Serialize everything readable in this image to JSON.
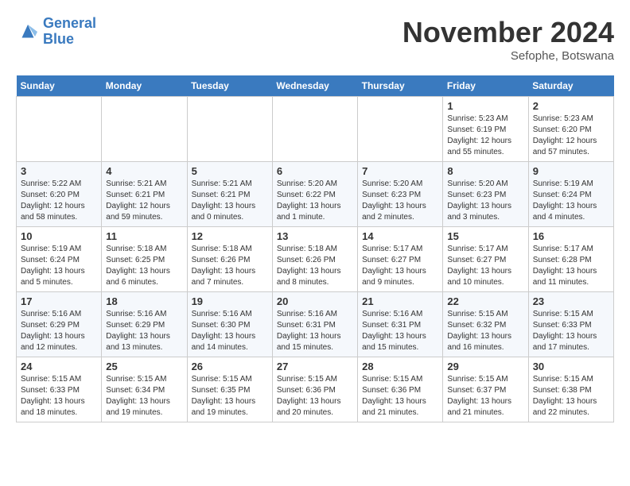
{
  "header": {
    "logo_line1": "General",
    "logo_line2": "Blue",
    "month_title": "November 2024",
    "location": "Sefophe, Botswana"
  },
  "days_of_week": [
    "Sunday",
    "Monday",
    "Tuesday",
    "Wednesday",
    "Thursday",
    "Friday",
    "Saturday"
  ],
  "weeks": [
    [
      {
        "day": "",
        "info": ""
      },
      {
        "day": "",
        "info": ""
      },
      {
        "day": "",
        "info": ""
      },
      {
        "day": "",
        "info": ""
      },
      {
        "day": "",
        "info": ""
      },
      {
        "day": "1",
        "info": "Sunrise: 5:23 AM\nSunset: 6:19 PM\nDaylight: 12 hours\nand 55 minutes."
      },
      {
        "day": "2",
        "info": "Sunrise: 5:23 AM\nSunset: 6:20 PM\nDaylight: 12 hours\nand 57 minutes."
      }
    ],
    [
      {
        "day": "3",
        "info": "Sunrise: 5:22 AM\nSunset: 6:20 PM\nDaylight: 12 hours\nand 58 minutes."
      },
      {
        "day": "4",
        "info": "Sunrise: 5:21 AM\nSunset: 6:21 PM\nDaylight: 12 hours\nand 59 minutes."
      },
      {
        "day": "5",
        "info": "Sunrise: 5:21 AM\nSunset: 6:21 PM\nDaylight: 13 hours\nand 0 minutes."
      },
      {
        "day": "6",
        "info": "Sunrise: 5:20 AM\nSunset: 6:22 PM\nDaylight: 13 hours\nand 1 minute."
      },
      {
        "day": "7",
        "info": "Sunrise: 5:20 AM\nSunset: 6:23 PM\nDaylight: 13 hours\nand 2 minutes."
      },
      {
        "day": "8",
        "info": "Sunrise: 5:20 AM\nSunset: 6:23 PM\nDaylight: 13 hours\nand 3 minutes."
      },
      {
        "day": "9",
        "info": "Sunrise: 5:19 AM\nSunset: 6:24 PM\nDaylight: 13 hours\nand 4 minutes."
      }
    ],
    [
      {
        "day": "10",
        "info": "Sunrise: 5:19 AM\nSunset: 6:24 PM\nDaylight: 13 hours\nand 5 minutes."
      },
      {
        "day": "11",
        "info": "Sunrise: 5:18 AM\nSunset: 6:25 PM\nDaylight: 13 hours\nand 6 minutes."
      },
      {
        "day": "12",
        "info": "Sunrise: 5:18 AM\nSunset: 6:26 PM\nDaylight: 13 hours\nand 7 minutes."
      },
      {
        "day": "13",
        "info": "Sunrise: 5:18 AM\nSunset: 6:26 PM\nDaylight: 13 hours\nand 8 minutes."
      },
      {
        "day": "14",
        "info": "Sunrise: 5:17 AM\nSunset: 6:27 PM\nDaylight: 13 hours\nand 9 minutes."
      },
      {
        "day": "15",
        "info": "Sunrise: 5:17 AM\nSunset: 6:27 PM\nDaylight: 13 hours\nand 10 minutes."
      },
      {
        "day": "16",
        "info": "Sunrise: 5:17 AM\nSunset: 6:28 PM\nDaylight: 13 hours\nand 11 minutes."
      }
    ],
    [
      {
        "day": "17",
        "info": "Sunrise: 5:16 AM\nSunset: 6:29 PM\nDaylight: 13 hours\nand 12 minutes."
      },
      {
        "day": "18",
        "info": "Sunrise: 5:16 AM\nSunset: 6:29 PM\nDaylight: 13 hours\nand 13 minutes."
      },
      {
        "day": "19",
        "info": "Sunrise: 5:16 AM\nSunset: 6:30 PM\nDaylight: 13 hours\nand 14 minutes."
      },
      {
        "day": "20",
        "info": "Sunrise: 5:16 AM\nSunset: 6:31 PM\nDaylight: 13 hours\nand 15 minutes."
      },
      {
        "day": "21",
        "info": "Sunrise: 5:16 AM\nSunset: 6:31 PM\nDaylight: 13 hours\nand 15 minutes."
      },
      {
        "day": "22",
        "info": "Sunrise: 5:15 AM\nSunset: 6:32 PM\nDaylight: 13 hours\nand 16 minutes."
      },
      {
        "day": "23",
        "info": "Sunrise: 5:15 AM\nSunset: 6:33 PM\nDaylight: 13 hours\nand 17 minutes."
      }
    ],
    [
      {
        "day": "24",
        "info": "Sunrise: 5:15 AM\nSunset: 6:33 PM\nDaylight: 13 hours\nand 18 minutes."
      },
      {
        "day": "25",
        "info": "Sunrise: 5:15 AM\nSunset: 6:34 PM\nDaylight: 13 hours\nand 19 minutes."
      },
      {
        "day": "26",
        "info": "Sunrise: 5:15 AM\nSunset: 6:35 PM\nDaylight: 13 hours\nand 19 minutes."
      },
      {
        "day": "27",
        "info": "Sunrise: 5:15 AM\nSunset: 6:36 PM\nDaylight: 13 hours\nand 20 minutes."
      },
      {
        "day": "28",
        "info": "Sunrise: 5:15 AM\nSunset: 6:36 PM\nDaylight: 13 hours\nand 21 minutes."
      },
      {
        "day": "29",
        "info": "Sunrise: 5:15 AM\nSunset: 6:37 PM\nDaylight: 13 hours\nand 21 minutes."
      },
      {
        "day": "30",
        "info": "Sunrise: 5:15 AM\nSunset: 6:38 PM\nDaylight: 13 hours\nand 22 minutes."
      }
    ]
  ]
}
